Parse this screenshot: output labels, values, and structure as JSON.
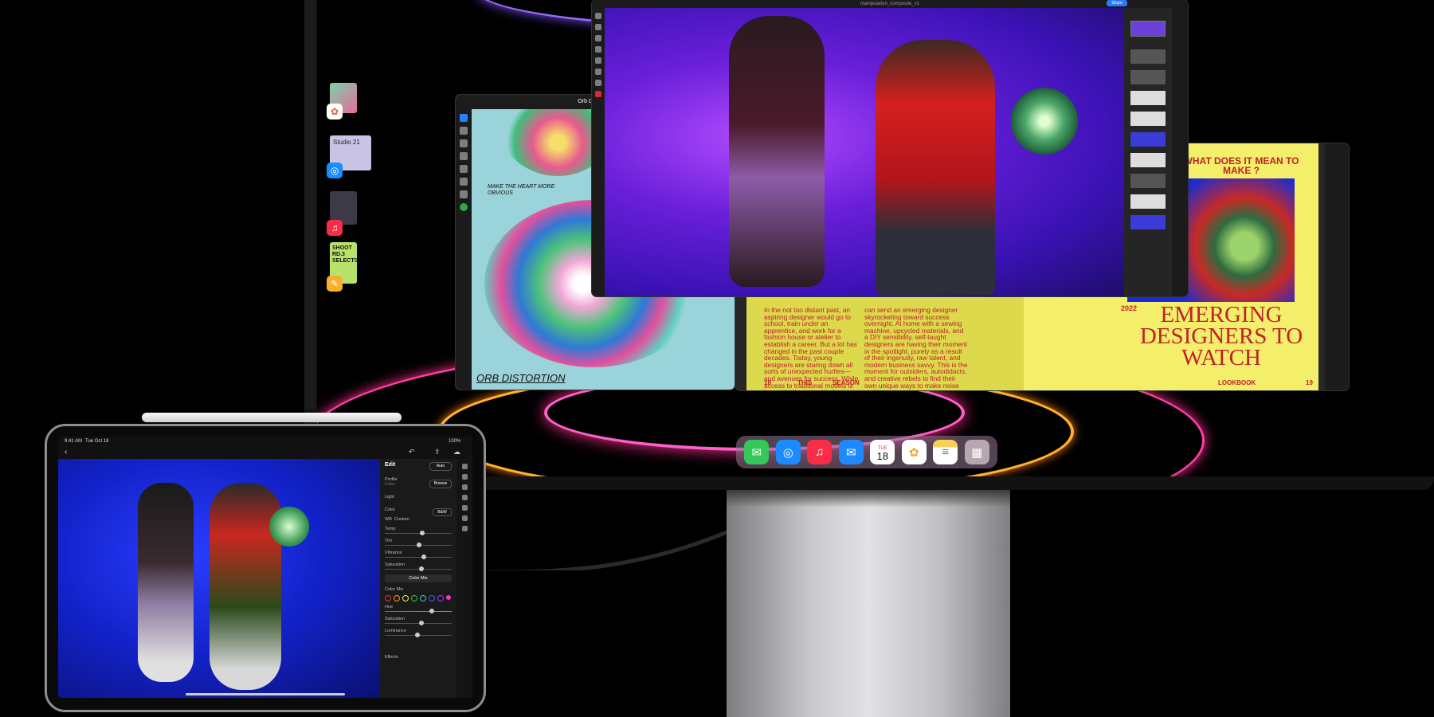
{
  "ipad_status": {
    "time": "9:41 AM",
    "date": "Tue Oct 18",
    "battery": "100%"
  },
  "lightroom": {
    "panel_title": "Edit",
    "auto_label": "Auto",
    "profile_label": "Profile",
    "profile_value": "Color",
    "browse_label": "Browse",
    "light_label": "Light",
    "color_label": "Color",
    "bw_label": "B&W",
    "wb_label": "WB",
    "wb_value": "Custom",
    "sliders": [
      {
        "label": "Temp",
        "value": "+5"
      },
      {
        "label": "Tint",
        "value": "-5"
      },
      {
        "label": "Vibrance",
        "value": "+9"
      },
      {
        "label": "Saturation",
        "value": "+3"
      }
    ],
    "color_mix_button": "Color Mix",
    "color_mix_label": "Color Mix",
    "mix_sliders": [
      {
        "label": "Hue",
        "value": "+40"
      },
      {
        "label": "Saturation",
        "value": "+3"
      },
      {
        "label": "Luminance",
        "value": "-9"
      }
    ],
    "effects_label": "Effects"
  },
  "procreate": {
    "title": "Orb Distortion",
    "sketch_note": "MAKE THE HEART MORE OBVIOUS",
    "caption": "ORB DISTORTION"
  },
  "photoshop": {
    "file_title": "manipulation_composite_v1",
    "share_label": "Share"
  },
  "magazine": {
    "heading": "WHAT DOES IT MEAN TO MAKE ?",
    "year": "2022",
    "headline": "EMERGING DESIGNERS TO WATCH",
    "col1": "In the not too distant past, an aspiring designer would go to school, train under an apprentice, and work for a fashion house or atelier to establish a career. But a lot has changed in the past couple decades. Today, young designers are staring down all sorts of unexpected hurtles—and avenues for success. While access to traditional models is increasingly untenable for many young artists, online exposure",
    "col2": "can send an emerging designer skyrocketing toward success overnight. At home with a sewing machine, upcycled materials, and a DIY sensibility, self-taught designers are having their moment in the spotlight, purely as a result of their ingenuity, raw talent, and modern business savvy. This is the moment for outsiders, autodidacts, and creative rebels to find their own unique ways to make noise and be seen.",
    "footer_left_page": "18",
    "footer_this": "THIS",
    "footer_season": "SEASON",
    "footer_lookbook": "LOOKBOOK",
    "footer_right_page": "19"
  },
  "stage_manager": [
    {
      "app": "Photos",
      "badge_icon": "photos-icon"
    },
    {
      "app": "Safari",
      "badge_icon": "safari-icon",
      "thumb_text": "Studio 21"
    },
    {
      "app": "Music",
      "badge_icon": "music-icon"
    },
    {
      "app": "Notes",
      "badge_icon": "notes-icon",
      "thumb_text": "SHOOT RD.3 SELECTS"
    }
  ],
  "dock": {
    "apps": [
      "Messages",
      "Safari",
      "Music",
      "Mail",
      "Calendar",
      "Photos",
      "Notes",
      "Utilities"
    ],
    "calendar_day": "TUE",
    "calendar_date": "18"
  },
  "colors": {
    "accent_pink": "#ff2d8c",
    "magazine_yellow": "#f3ef6a",
    "magazine_red": "#c2202a"
  }
}
